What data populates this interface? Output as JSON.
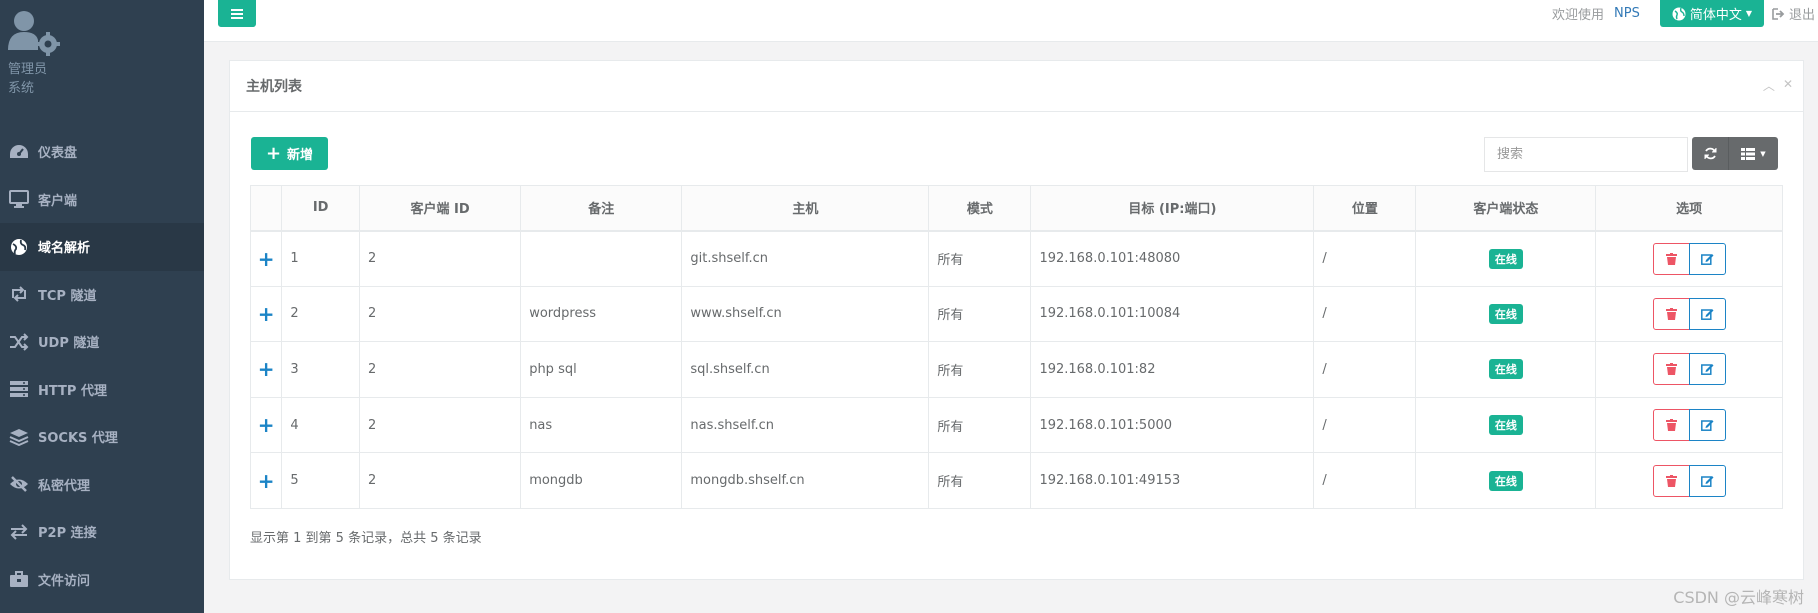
{
  "sidebar": {
    "user_name": "管理员",
    "user_role": "系统",
    "items": [
      {
        "label": "仪表盘",
        "icon": "dashboard-icon"
      },
      {
        "label": "客户端",
        "icon": "desktop-icon"
      },
      {
        "label": "域名解析",
        "icon": "globe-icon",
        "active": true
      },
      {
        "label": "TCP 隧道",
        "icon": "retweet-icon"
      },
      {
        "label": "UDP 隧道",
        "icon": "random-icon"
      },
      {
        "label": "HTTP 代理",
        "icon": "server-icon"
      },
      {
        "label": "SOCKS 代理",
        "icon": "layers-icon"
      },
      {
        "label": "私密代理",
        "icon": "eye-slash-icon"
      },
      {
        "label": "P2P 连接",
        "icon": "exchange-icon"
      },
      {
        "label": "文件访问",
        "icon": "briefcase-icon"
      }
    ]
  },
  "topbar": {
    "welcome": "欢迎使用",
    "nps": "NPS",
    "language": "简体中文",
    "logout": "退出"
  },
  "panel": {
    "title": "主机列表",
    "add_label": "新增",
    "search_placeholder": "搜索"
  },
  "table": {
    "headers": [
      "",
      "ID",
      "客户端 ID",
      "备注",
      "主机",
      "模式",
      "目标 (IP:端口)",
      "位置",
      "客户端状态",
      "选项"
    ],
    "rows": [
      {
        "expand": "+",
        "id": "1",
        "client_id": "2",
        "remark": "",
        "host": "git.shself.cn",
        "mode": "所有",
        "target": "192.168.0.101:48080",
        "location": "/",
        "status": "在线"
      },
      {
        "expand": "+",
        "id": "2",
        "client_id": "2",
        "remark": "wordpress",
        "host": "www.shself.cn",
        "mode": "所有",
        "target": "192.168.0.101:10084",
        "location": "/",
        "status": "在线"
      },
      {
        "expand": "+",
        "id": "3",
        "client_id": "2",
        "remark": "php sql",
        "host": "sql.shself.cn",
        "mode": "所有",
        "target": "192.168.0.101:82",
        "location": "/",
        "status": "在线"
      },
      {
        "expand": "+",
        "id": "4",
        "client_id": "2",
        "remark": "nas",
        "host": "nas.shself.cn",
        "mode": "所有",
        "target": "192.168.0.101:5000",
        "location": "/",
        "status": "在线"
      },
      {
        "expand": "+",
        "id": "5",
        "client_id": "2",
        "remark": "mongdb",
        "host": "mongdb.shself.cn",
        "mode": "所有",
        "target": "192.168.0.101:49153",
        "location": "/",
        "status": "在线"
      }
    ]
  },
  "pagination": {
    "info": "显示第 1 到第 5 条记录，总共 5 条记录"
  },
  "watermark": "CSDN @云峰寒树",
  "colors": {
    "sidebar": "#2f4050",
    "accent": "#1ab394",
    "danger": "#ed5565",
    "primary": "#1c84c6"
  }
}
